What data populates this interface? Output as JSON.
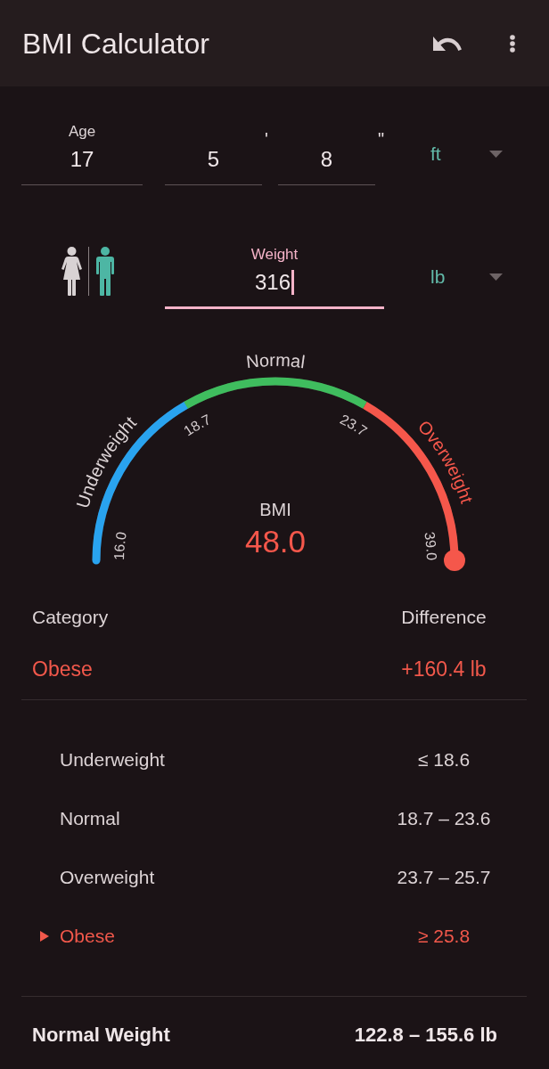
{
  "app_bar": {
    "title": "BMI Calculator"
  },
  "age": {
    "label": "Age",
    "value": "17",
    "focused": false
  },
  "height": {
    "feet": {
      "value": "5",
      "mark": "'",
      "focused": false
    },
    "inches": {
      "value": "8",
      "mark": "\"",
      "focused": false
    },
    "unit": "ft"
  },
  "gender": [
    {
      "kind": "female",
      "selected": false
    },
    {
      "kind": "male",
      "selected": true
    }
  ],
  "weight": {
    "label": "Weight",
    "value": "316",
    "focused": true,
    "unit": "lb"
  },
  "gauge": {
    "sections": [
      {
        "label": "Underweight",
        "color": "#29a3ef",
        "highlighted": false
      },
      {
        "label": "Normal",
        "color": "#3fbd5e",
        "highlighted": false
      },
      {
        "label": "Overweight",
        "color": "#f5574b",
        "highlighted": true
      }
    ],
    "ticks": [
      "16.0",
      "18.7",
      "23.7",
      "39.0"
    ],
    "caption": "BMI",
    "value": "48.0",
    "level": 1
  },
  "result": {
    "columns": [
      "Category",
      "Difference"
    ],
    "category": "Obese",
    "difference": "+160.4 lb"
  },
  "categories": [
    {
      "name": "Underweight",
      "range": "≤ 18.6",
      "selected": false
    },
    {
      "name": "Normal",
      "range": "18.7 – 23.6",
      "selected": false
    },
    {
      "name": "Overweight",
      "range": "23.7 – 25.7",
      "selected": false
    },
    {
      "name": "Obese",
      "range": "≥ 25.8",
      "selected": true
    }
  ],
  "normal_weight": {
    "label": "Normal Weight",
    "value": "122.8 – 155.6 lb"
  }
}
